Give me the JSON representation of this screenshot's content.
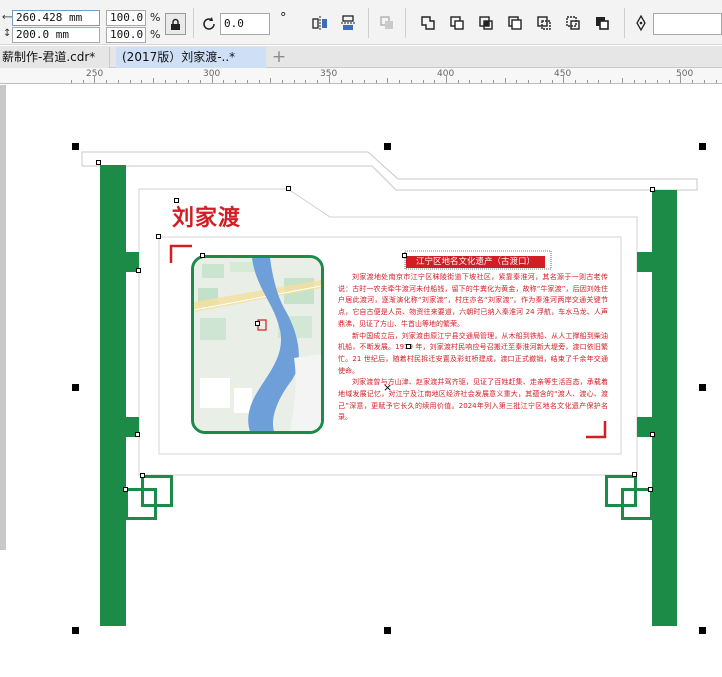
{
  "toolbar": {
    "width_value": "260.428 mm",
    "height_value": "200.0 mm",
    "scale_x": "100.0",
    "scale_y": "100.0",
    "percent_symbol": "%",
    "rotation_value": "0.0",
    "degree_symbol": "°"
  },
  "tabs": [
    {
      "label": "薪制作-君道.cdr*",
      "active": false
    },
    {
      "label": "(2017版）刘家渡-..*",
      "active": true
    }
  ],
  "ruler": {
    "labels": [
      "250",
      "300",
      "350",
      "400",
      "450",
      "500"
    ]
  },
  "sign": {
    "title": "刘家渡",
    "subtitle": "江宁区地名文化遗产（古渡口）",
    "paragraphs": [
      "刘家渡地处南京市江宁区秣陵街道下坡社区，紧靠秦淮河，其名源于一则古老传说：古时一农夫牵牛渡河未付船钱，留下的牛粪化为黄金，故称“牛家渡”，后因刘姓住户居此渡河，逐渐演化称“刘家渡”，村庄亦名“刘家渡”。作为秦淮河两岸交通关键节点，它自古便是人员、物资往来要道，六朝时已纳入秦淮河 24 浮航，车水马龙、人声鼎沸，见证了方山、牛首山等地的繁荣。",
      "新中国成立后，刘家渡由原江宁县交通局管理，从木船到铁船、从人工撑船到柴油机船，不断发展。1979 年，刘家渡村民响应号召搬迁至秦淮河新大堤旁，渡口依旧繁忙。21 世纪后，随着村民拆迁安置及彩虹桥建成，渡口正式撤销，结束了千余年交通使命。",
      "刘家渡曾与方山津、赵家渡并驾齐驱，见证了百姓赶集、走亲等生活百态，承载着地域发展记忆，对江宁及江南地区经济社会发展意义重大，其蕴含的“渡人、渡心、渡己”深意，更赋予它长久的续用价值。2024年列入第三批江宁区地名文化遗产保护名录。"
    ]
  },
  "colors": {
    "accent_green": "#1b8b47",
    "accent_red": "#d21d24",
    "river_blue": "#6f9fd8"
  }
}
